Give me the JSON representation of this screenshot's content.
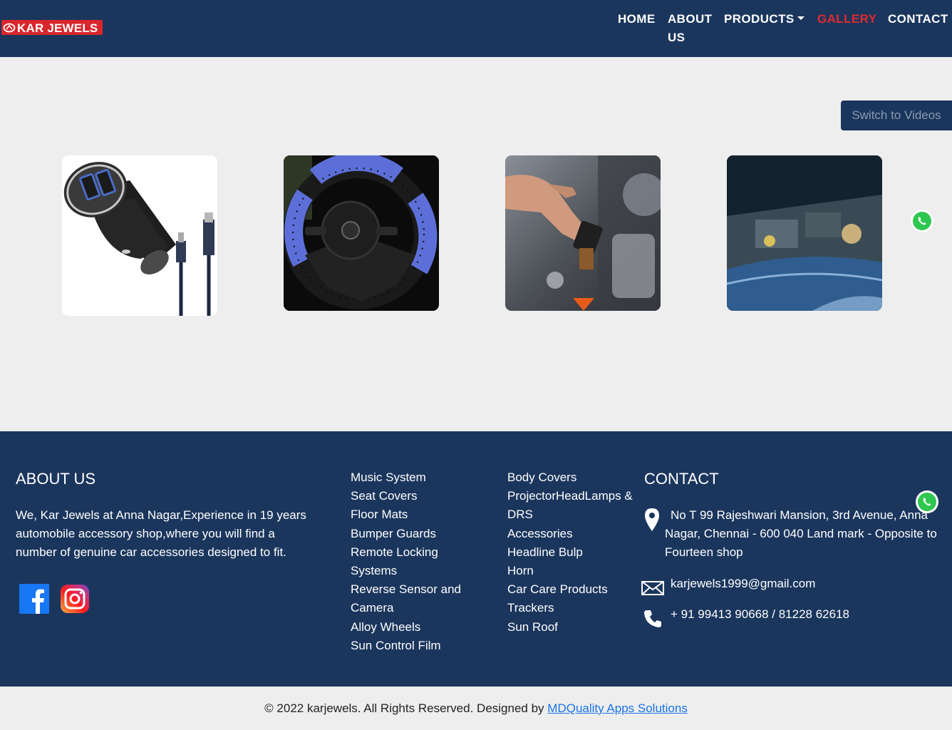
{
  "brand": {
    "name": "KAR JEWELS"
  },
  "nav": {
    "home": "HOME",
    "about": "ABOUT US",
    "products": "PRODUCTS",
    "gallery": "GALLERY",
    "contact": "CONTACT"
  },
  "gallery": {
    "switch_label": "Switch to Videos",
    "items": [
      "car-charger",
      "steering-cover",
      "headlight-bulb",
      "engine-bay"
    ]
  },
  "footer": {
    "about_heading": "ABOUT US",
    "about_text": "We, Kar Jewels at Anna Nagar,Experience in 19 years automobile accessory shop,where you will find a number of genuine car accessories designed to fit.",
    "products_col1": [
      "Music System",
      "Seat Covers",
      "Floor Mats",
      "Bumper Guards",
      "Remote Locking Systems",
      "Reverse Sensor and Camera",
      "Alloy Wheels",
      "Sun Control Film"
    ],
    "products_col2": [
      "Body Covers",
      "ProjectorHeadLamps & DRS",
      "Accessories",
      "Headline Bulp",
      "Horn",
      "Car Care Products",
      "Trackers",
      "Sun Roof"
    ],
    "contact_heading": "CONTACT",
    "address": "No T 99 Rajeshwari Mansion, 3rd Avenue, Anna Nagar, Chennai - 600 040 Land mark - Opposite to Fourteen shop",
    "email": "karjewels1999@gmail.com",
    "phone": "+ 91 99413 90668 / 81228 62618"
  },
  "copyright": {
    "text": "© 2022 karjewels. All Rights Reserved. Designed by",
    "link": "MDQuality Apps Solutions"
  },
  "colors": {
    "navy": "#1b365d",
    "accent_red": "#e02a2f",
    "link_blue": "#1a73e8",
    "page_bg": "#eeeeee"
  }
}
